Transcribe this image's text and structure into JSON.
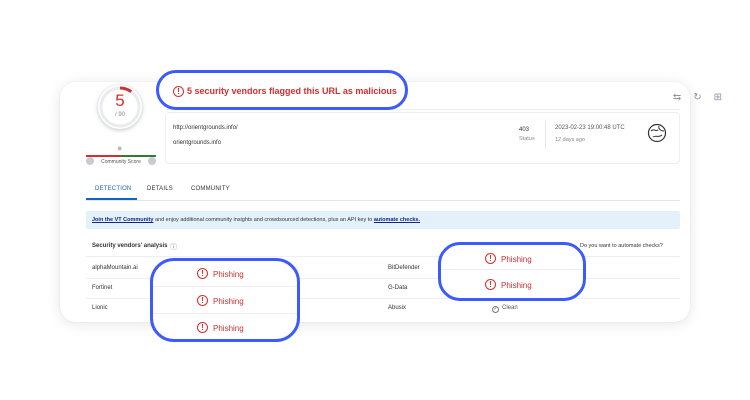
{
  "score": {
    "value": "5",
    "total": "/ 90"
  },
  "community": {
    "label": "Community Score"
  },
  "alert_banner": "5 security vendors flagged this URL as malicious",
  "url": {
    "line1": "http://orientgrounds.info/",
    "line2": "orientgrounds.info"
  },
  "status": {
    "code": "403",
    "label": "Status"
  },
  "date": {
    "timestamp": "2023-02-23 19:00:48 UTC",
    "ago": "12 days ago"
  },
  "tabs": [
    "DETECTION",
    "DETAILS",
    "COMMUNITY"
  ],
  "banner": {
    "link1": "Join the VT Community",
    "middle": " and enjoy additional community insights and crowdsourced detections, plus an API key to ",
    "link2": "automate checks."
  },
  "section": {
    "title": "Security vendors' analysis",
    "automate": "Do you want to automate checks?"
  },
  "vendors_left": [
    "alphaMountain.ai",
    "Fortinet",
    "Lionic"
  ],
  "vendors_right": [
    "BitDefender",
    "G-Data",
    "Abusix"
  ],
  "results_left": [
    "Phishing",
    "Phishing",
    "Phishing"
  ],
  "results_right": [
    "Phishing",
    "Phishing"
  ],
  "clean_label": "Clean",
  "colors": {
    "malicious": "#d32f2f",
    "highlight": "#3d5afe",
    "link": "#1565c0"
  }
}
